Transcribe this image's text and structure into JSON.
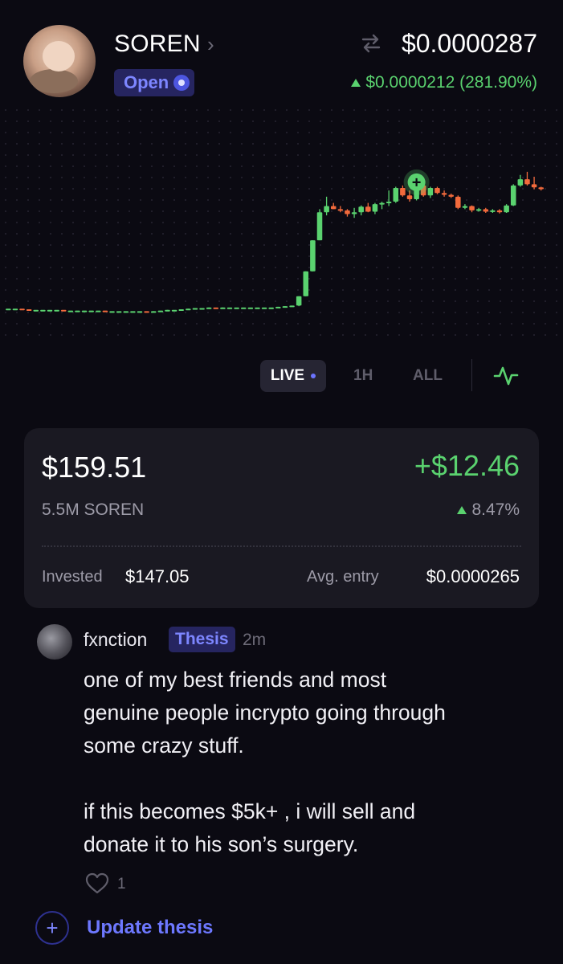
{
  "token": {
    "name": "SOREN",
    "status": "Open",
    "price": "$0.0000287",
    "change": "$0.0000212 (281.90%)",
    "colors": {
      "positive": "#5ad26f",
      "negative": "#f26a3c",
      "accent": "#6c74ff"
    }
  },
  "icons": [
    "chevron-right-icon",
    "swap-icon",
    "pulse-icon",
    "heart-icon",
    "plus-icon"
  ],
  "range_tabs": {
    "live": "LIVE",
    "h1": "1H",
    "all": "ALL"
  },
  "position": {
    "value": "$159.51",
    "pnl": "+$12.46",
    "quantity": "5.5M SOREN",
    "pnl_percent": "8.47%",
    "invested_label": "Invested",
    "invested_value": "$147.05",
    "avg_entry_label": "Avg. entry",
    "avg_entry_value": "$0.0000265"
  },
  "post": {
    "username": "fxnction",
    "tag": "Thesis",
    "time": "2m",
    "body": "one of my best friends and most\ngenuine people incrypto going through\nsome crazy stuff.\n\nif this becomes $5k+ , i will sell and\ndonate it to his son’s surgery.",
    "likes": "1"
  },
  "update_thesis": "Update thesis",
  "chart_data": {
    "type": "candlestick",
    "grid": "dotted",
    "marker": "entry point (+)",
    "candles": [
      {
        "o": 0.9,
        "h": 0.9,
        "l": 0.9,
        "c": 0.9
      },
      {
        "o": 0.9,
        "h": 0.9,
        "l": 0.9,
        "c": 0.9
      },
      {
        "o": 0.9,
        "h": 0.9,
        "l": 0.9,
        "c": 0.89
      },
      {
        "o": 0.89,
        "h": 0.89,
        "l": 0.89,
        "c": 0.88
      },
      {
        "o": 0.88,
        "h": 0.88,
        "l": 0.88,
        "c": 0.88
      },
      {
        "o": 0.88,
        "h": 0.88,
        "l": 0.88,
        "c": 0.88
      },
      {
        "o": 0.88,
        "h": 0.88,
        "l": 0.88,
        "c": 0.88
      },
      {
        "o": 0.88,
        "h": 0.88,
        "l": 0.88,
        "c": 0.88
      },
      {
        "o": 0.88,
        "h": 0.88,
        "l": 0.88,
        "c": 0.87
      },
      {
        "o": 0.87,
        "h": 0.87,
        "l": 0.87,
        "c": 0.87
      },
      {
        "o": 0.87,
        "h": 0.87,
        "l": 0.87,
        "c": 0.87
      },
      {
        "o": 0.87,
        "h": 0.87,
        "l": 0.87,
        "c": 0.87
      },
      {
        "o": 0.87,
        "h": 0.87,
        "l": 0.87,
        "c": 0.87
      },
      {
        "o": 0.87,
        "h": 0.87,
        "l": 0.87,
        "c": 0.87
      },
      {
        "o": 0.87,
        "h": 0.87,
        "l": 0.87,
        "c": 0.86
      },
      {
        "o": 0.86,
        "h": 0.86,
        "l": 0.86,
        "c": 0.86
      },
      {
        "o": 0.86,
        "h": 0.86,
        "l": 0.86,
        "c": 0.86
      },
      {
        "o": 0.86,
        "h": 0.86,
        "l": 0.86,
        "c": 0.86
      },
      {
        "o": 0.86,
        "h": 0.86,
        "l": 0.86,
        "c": 0.86
      },
      {
        "o": 0.86,
        "h": 0.86,
        "l": 0.86,
        "c": 0.86
      },
      {
        "o": 0.86,
        "h": 0.86,
        "l": 0.86,
        "c": 0.85
      },
      {
        "o": 0.85,
        "h": 0.86,
        "l": 0.85,
        "c": 0.86
      },
      {
        "o": 0.86,
        "h": 0.86,
        "l": 0.86,
        "c": 0.87
      },
      {
        "o": 0.87,
        "h": 0.88,
        "l": 0.87,
        "c": 0.88
      },
      {
        "o": 0.88,
        "h": 0.88,
        "l": 0.88,
        "c": 0.88
      },
      {
        "o": 0.88,
        "h": 0.89,
        "l": 0.88,
        "c": 0.89
      },
      {
        "o": 0.89,
        "h": 0.9,
        "l": 0.89,
        "c": 0.9
      },
      {
        "o": 0.9,
        "h": 0.91,
        "l": 0.9,
        "c": 0.91
      },
      {
        "o": 0.91,
        "h": 0.91,
        "l": 0.9,
        "c": 0.91
      },
      {
        "o": 0.91,
        "h": 0.92,
        "l": 0.91,
        "c": 0.92
      },
      {
        "o": 0.92,
        "h": 0.92,
        "l": 0.92,
        "c": 0.91
      },
      {
        "o": 0.91,
        "h": 0.92,
        "l": 0.91,
        "c": 0.92
      },
      {
        "o": 0.92,
        "h": 0.92,
        "l": 0.92,
        "c": 0.92
      },
      {
        "o": 0.92,
        "h": 0.92,
        "l": 0.92,
        "c": 0.92
      },
      {
        "o": 0.92,
        "h": 0.92,
        "l": 0.92,
        "c": 0.92
      },
      {
        "o": 0.92,
        "h": 0.92,
        "l": 0.92,
        "c": 0.92
      },
      {
        "o": 0.92,
        "h": 0.92,
        "l": 0.92,
        "c": 0.92
      },
      {
        "o": 0.92,
        "h": 0.92,
        "l": 0.92,
        "c": 0.92
      },
      {
        "o": 0.92,
        "h": 0.92,
        "l": 0.92,
        "c": 0.92
      },
      {
        "o": 0.92,
        "h": 0.93,
        "l": 0.92,
        "c": 0.93
      },
      {
        "o": 0.93,
        "h": 0.94,
        "l": 0.93,
        "c": 0.94
      },
      {
        "o": 0.94,
        "h": 0.95,
        "l": 0.94,
        "c": 0.95
      },
      {
        "o": 0.95,
        "h": 1.1,
        "l": 0.94,
        "c": 1.1
      },
      {
        "o": 1.1,
        "h": 1.5,
        "l": 1.1,
        "c": 1.5
      },
      {
        "o": 1.5,
        "h": 2.0,
        "l": 1.5,
        "c": 2.0
      },
      {
        "o": 2.0,
        "h": 2.5,
        "l": 2.0,
        "c": 2.45
      },
      {
        "o": 2.45,
        "h": 2.7,
        "l": 2.4,
        "c": 2.55
      },
      {
        "o": 2.55,
        "h": 2.6,
        "l": 2.5,
        "c": 2.5
      },
      {
        "o": 2.5,
        "h": 2.55,
        "l": 2.45,
        "c": 2.48
      },
      {
        "o": 2.48,
        "h": 2.5,
        "l": 2.38,
        "c": 2.42
      },
      {
        "o": 2.42,
        "h": 2.52,
        "l": 2.36,
        "c": 2.45
      },
      {
        "o": 2.45,
        "h": 2.56,
        "l": 2.4,
        "c": 2.54
      },
      {
        "o": 2.54,
        "h": 2.6,
        "l": 2.45,
        "c": 2.46
      },
      {
        "o": 2.46,
        "h": 2.6,
        "l": 2.42,
        "c": 2.58
      },
      {
        "o": 2.58,
        "h": 2.62,
        "l": 2.5,
        "c": 2.6
      },
      {
        "o": 2.6,
        "h": 2.8,
        "l": 2.55,
        "c": 2.62
      },
      {
        "o": 2.62,
        "h": 2.86,
        "l": 2.6,
        "c": 2.84
      },
      {
        "o": 2.84,
        "h": 2.88,
        "l": 2.7,
        "c": 2.72
      },
      {
        "o": 2.72,
        "h": 2.8,
        "l": 2.62,
        "c": 2.66
      },
      {
        "o": 2.66,
        "h": 2.9,
        "l": 2.64,
        "c": 2.88
      },
      {
        "o": 2.88,
        "h": 2.92,
        "l": 2.7,
        "c": 2.72
      },
      {
        "o": 2.72,
        "h": 2.86,
        "l": 2.68,
        "c": 2.84
      },
      {
        "o": 2.84,
        "h": 2.86,
        "l": 2.74,
        "c": 2.76
      },
      {
        "o": 2.76,
        "h": 2.8,
        "l": 2.7,
        "c": 2.73
      },
      {
        "o": 2.73,
        "h": 2.75,
        "l": 2.68,
        "c": 2.7
      },
      {
        "o": 2.7,
        "h": 2.72,
        "l": 2.5,
        "c": 2.52
      },
      {
        "o": 2.52,
        "h": 2.58,
        "l": 2.5,
        "c": 2.55
      },
      {
        "o": 2.55,
        "h": 2.56,
        "l": 2.45,
        "c": 2.48
      },
      {
        "o": 2.48,
        "h": 2.52,
        "l": 2.46,
        "c": 2.5
      },
      {
        "o": 2.5,
        "h": 2.52,
        "l": 2.44,
        "c": 2.46
      },
      {
        "o": 2.46,
        "h": 2.5,
        "l": 2.44,
        "c": 2.48
      },
      {
        "o": 2.48,
        "h": 2.5,
        "l": 2.43,
        "c": 2.45
      },
      {
        "o": 2.45,
        "h": 2.58,
        "l": 2.44,
        "c": 2.56
      },
      {
        "o": 2.56,
        "h": 2.9,
        "l": 2.55,
        "c": 2.88
      },
      {
        "o": 2.88,
        "h": 3.05,
        "l": 2.86,
        "c": 2.98
      },
      {
        "o": 2.98,
        "h": 3.1,
        "l": 2.88,
        "c": 2.9
      },
      {
        "o": 2.9,
        "h": 3.02,
        "l": 2.82,
        "c": 2.85
      },
      {
        "o": 2.85,
        "h": 2.86,
        "l": 2.8,
        "c": 2.82
      }
    ]
  }
}
